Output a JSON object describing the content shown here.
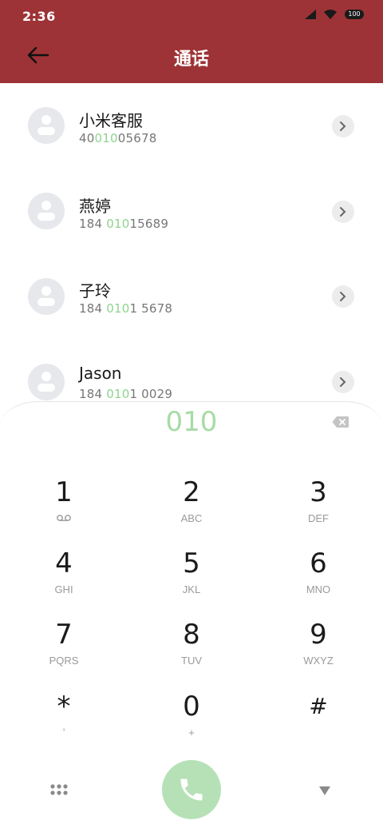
{
  "status_bar": {
    "time": "2:36",
    "battery": "100"
  },
  "header": {
    "title": "通话"
  },
  "contacts": [
    {
      "name": "小米客服",
      "number_pre": "40",
      "number_hl": "010",
      "number_post": "05678"
    },
    {
      "name": "燕婷",
      "number_pre": "184 ",
      "number_hl": "010",
      "number_post": "15689"
    },
    {
      "name": "子玲",
      "number_pre": "184 ",
      "number_hl": "010",
      "number_post": "1 5678"
    },
    {
      "name": "Jason",
      "number_pre": "184 ",
      "number_hl": "010",
      "number_post": "1 0029"
    }
  ],
  "dialer": {
    "input": "010",
    "keys": [
      {
        "digit": "1",
        "letters": ""
      },
      {
        "digit": "2",
        "letters": "ABC"
      },
      {
        "digit": "3",
        "letters": "DEF"
      },
      {
        "digit": "4",
        "letters": "GHI"
      },
      {
        "digit": "5",
        "letters": "JKL"
      },
      {
        "digit": "6",
        "letters": "MNO"
      },
      {
        "digit": "7",
        "letters": "PQRS"
      },
      {
        "digit": "8",
        "letters": "TUV"
      },
      {
        "digit": "9",
        "letters": "WXYZ"
      },
      {
        "digit": "*",
        "letters": ","
      },
      {
        "digit": "0",
        "letters": "+"
      },
      {
        "digit": "#",
        "letters": ""
      }
    ]
  },
  "colors": {
    "header_bg": "#9d3336",
    "highlight": "#8fd48d",
    "call_button": "#b6e1b7"
  },
  "icons": [
    "back-arrow-icon",
    "signal-icon",
    "wifi-icon",
    "battery-icon",
    "chevron-right-icon",
    "backspace-icon",
    "voicemail-icon",
    "dialpad-menu-icon",
    "phone-icon",
    "collapse-triangle-icon"
  ]
}
